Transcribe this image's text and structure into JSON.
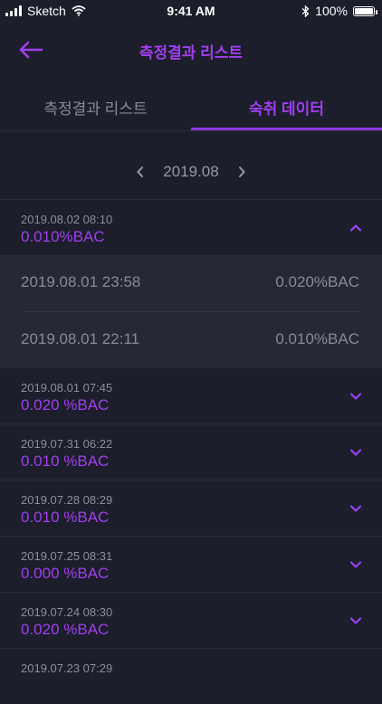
{
  "status": {
    "carrier": "Sketch",
    "time": "9:41 AM",
    "battery": "100%"
  },
  "nav": {
    "title": "측정결과 리스트"
  },
  "tabs": [
    {
      "label": "측정결과 리스트",
      "active": false
    },
    {
      "label": "숙취 데이터",
      "active": true
    }
  ],
  "month": {
    "label": "2019.08"
  },
  "expanded_item": {
    "date": "2019.08.02 08:10",
    "value": "0.010%BAC",
    "subitems": [
      {
        "date": "2019.08.01 23:58",
        "value": "0.020%BAC"
      },
      {
        "date": "2019.08.01 22:11",
        "value": "0.010%BAC"
      }
    ]
  },
  "items": [
    {
      "date": "2019.08.01 07:45",
      "value": "0.020 %BAC"
    },
    {
      "date": "2019.07.31 06:22",
      "value": "0.010 %BAC"
    },
    {
      "date": "2019.07.28 08:29",
      "value": "0.010 %BAC"
    },
    {
      "date": "2019.07.25 08:31",
      "value": "0.000 %BAC"
    },
    {
      "date": "2019.07.24 08:30",
      "value": "0.020 %BAC"
    },
    {
      "date": "2019.07.23 07:29",
      "value": ""
    }
  ],
  "colors": {
    "accent": "#a13ff0",
    "background": "#1c1e2b",
    "expanded_bg": "#262836"
  }
}
